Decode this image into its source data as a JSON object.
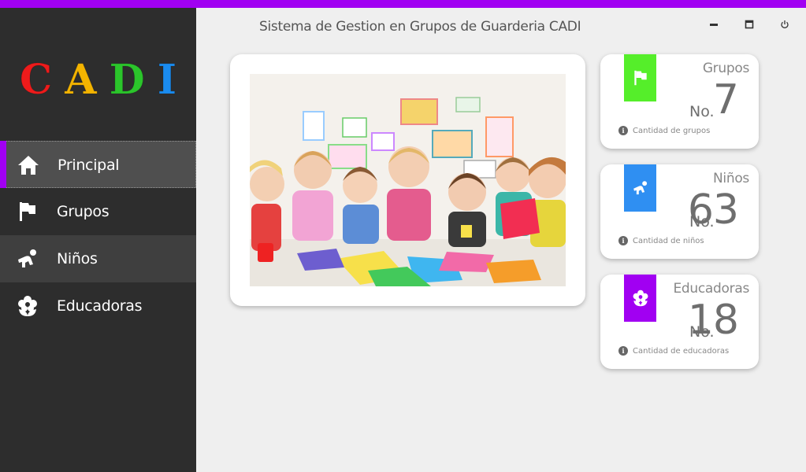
{
  "app": {
    "title": "Sistema de Gestion en Grupos de Guarderia CADI",
    "logo_letters": [
      {
        "char": "C",
        "color": "#ee1b1b"
      },
      {
        "char": "A",
        "color": "#f4b400"
      },
      {
        "char": "D",
        "color": "#2bc52b"
      },
      {
        "char": "I",
        "color": "#1a8cf0"
      }
    ],
    "accent": "#a100f2"
  },
  "sidebar": {
    "items": [
      {
        "label": "Principal",
        "icon": "home-icon",
        "active": true
      },
      {
        "label": "Grupos",
        "icon": "flag-icon",
        "active": false
      },
      {
        "label": "Niños",
        "icon": "child-icon",
        "active": false
      },
      {
        "label": "Educadoras",
        "icon": "flower-icon",
        "active": false
      }
    ]
  },
  "window_controls": {
    "minimize": "minimize-icon",
    "maximize": "maximize-icon",
    "power": "power-icon"
  },
  "stats": [
    {
      "name": "Grupos",
      "prefix": "No.",
      "value": "7",
      "footer": "Cantidad de grupos",
      "color": "#55ee2a",
      "icon": "flag-icon"
    },
    {
      "name": "Niños",
      "prefix": "No.",
      "value": "63",
      "footer": "Cantidad de niños",
      "color": "#2f8ff2",
      "icon": "child-icon"
    },
    {
      "name": "Educadoras",
      "prefix": "No.",
      "value": "18",
      "footer": "Cantidad de educadoras",
      "color": "#a100f2",
      "icon": "flower-icon"
    }
  ]
}
